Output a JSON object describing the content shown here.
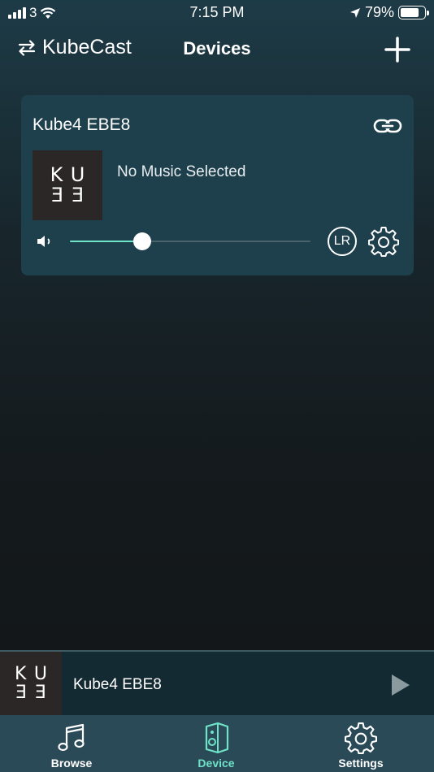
{
  "status_bar": {
    "carrier": "3",
    "time": "7:15 PM",
    "battery_percent": "79%",
    "battery_level": 0.79
  },
  "header": {
    "app_name": "KubeCast",
    "title": "Devices"
  },
  "device_card": {
    "name": "Kube4 EBE8",
    "track": "No Music Selected",
    "logo_top": "KU",
    "logo_bottom": "ƎƎ",
    "volume": 0.3,
    "channel_label": "LR"
  },
  "mini_player": {
    "logo_top": "KU",
    "logo_bottom": "ƎƎ",
    "device_name": "Kube4 EBE8"
  },
  "tabs": [
    {
      "label": "Browse",
      "icon": "music-note-icon"
    },
    {
      "label": "Device",
      "icon": "speaker-icon",
      "active": true
    },
    {
      "label": "Settings",
      "icon": "gear-icon"
    }
  ],
  "colors": {
    "accent": "#6fe3c8",
    "card": "#1e3f4c",
    "tab_bar": "#2b4a57"
  }
}
